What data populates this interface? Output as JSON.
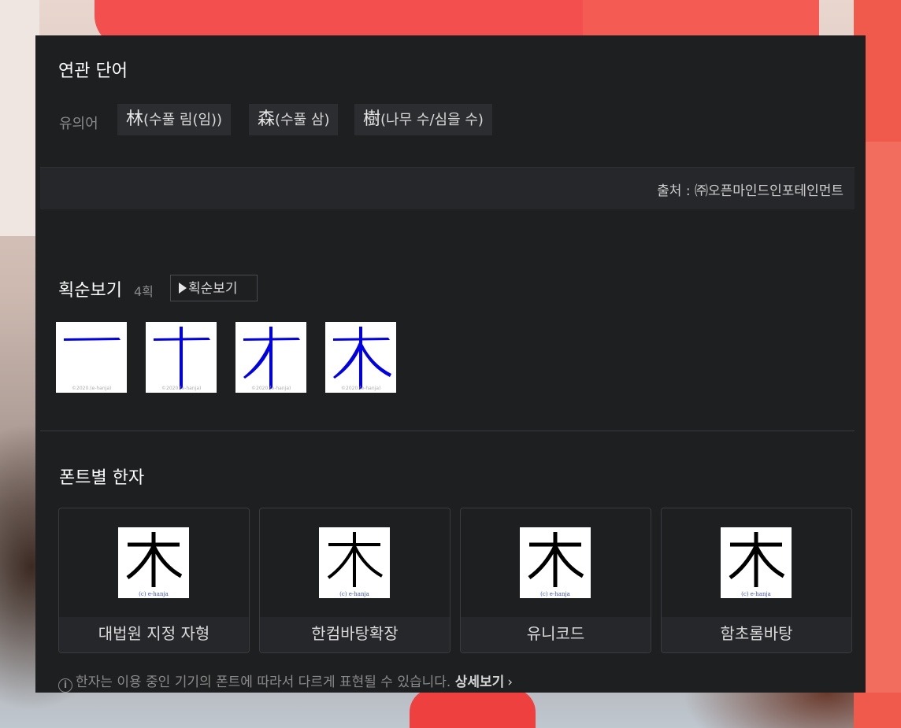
{
  "related": {
    "title": "연관 단어",
    "synonym_label": "유의어",
    "synonyms": [
      {
        "hanja": "林",
        "reading": "(수풀 림(임))"
      },
      {
        "hanja": "森",
        "reading": "(수풀 삼)"
      },
      {
        "hanja": "樹",
        "reading": "(나무 수/심을 수)"
      }
    ],
    "source": "출처 : ㈜오픈마인드인포테인먼트"
  },
  "stroke_order": {
    "title": "획순보기",
    "count": "4획",
    "button_label": "획순보기",
    "watermark": "©2020.(e-hanja)",
    "stroke_color": "#0000e6"
  },
  "font_hanja": {
    "title": "폰트별 한자",
    "character": "木",
    "watermark": "(c) e-hanja",
    "fonts": [
      {
        "name": "대법원 지정 자형"
      },
      {
        "name": "한컴바탕확장"
      },
      {
        "name": "유니코드"
      },
      {
        "name": "함초롬바탕"
      }
    ],
    "notice": "한자는 이용 중인 기기의 폰트에 따라서 다르게 표현될 수 있습니다.",
    "more_label": "상세보기",
    "info_icon": "info-circle-icon",
    "chevron_icon": "chevron-right-icon"
  }
}
